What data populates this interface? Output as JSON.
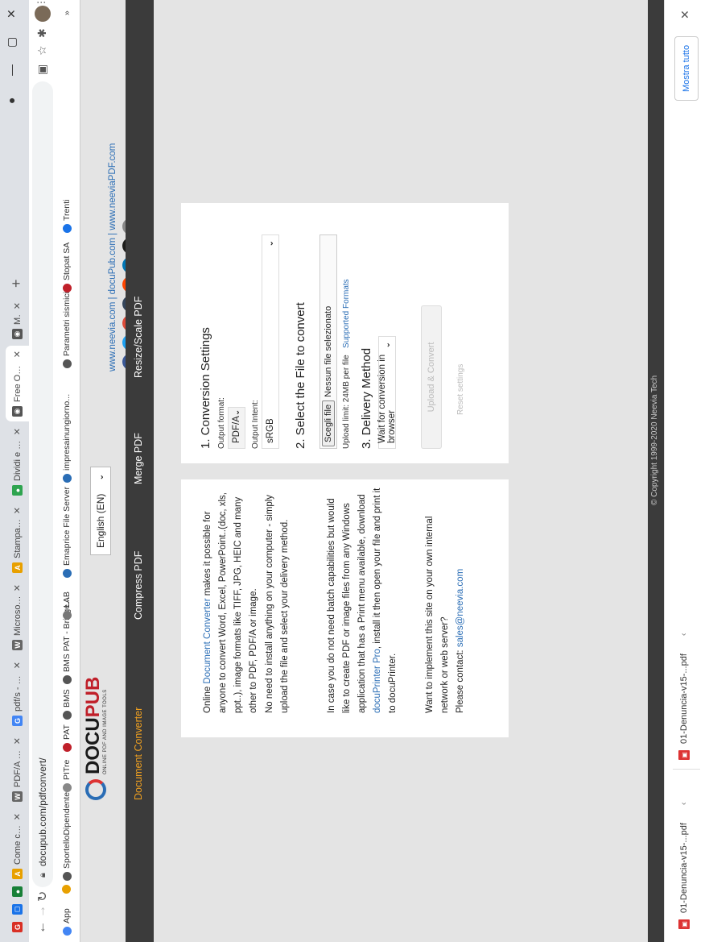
{
  "browser": {
    "tabs": [
      {
        "label": "",
        "icon_color": "#d93025",
        "icon_text": "G"
      },
      {
        "label": "",
        "icon_color": "#1a73e8",
        "icon_text": "◻"
      },
      {
        "label": "",
        "icon_color": "#188038",
        "icon_text": "●"
      },
      {
        "label": "Come conv",
        "icon_color": "#e8a000",
        "icon_text": "A"
      },
      {
        "label": "PDF/A - Wik",
        "icon_color": "#666666",
        "icon_text": "W"
      },
      {
        "label": "pdf/s - Rice",
        "icon_color": "#4285f4",
        "icon_text": "G"
      },
      {
        "label": "Microsoft W",
        "icon_color": "#666666",
        "icon_text": "W"
      },
      {
        "label": "Stampante",
        "icon_color": "#e8a000",
        "icon_text": "A"
      },
      {
        "label": "Dividi e unir",
        "icon_color": "#2ea44f",
        "icon_text": "●"
      },
      {
        "label": "Free Online",
        "icon_color": "#555555",
        "icon_text": "◉"
      },
      {
        "label": "Mod",
        "icon_color": "#555555",
        "icon_text": "◉"
      }
    ],
    "url": "docupub.com/pdfconvert/",
    "bookmarks": [
      {
        "label": "App",
        "color": "#4285f4"
      },
      {
        "label": "",
        "color": "#e8a000"
      },
      {
        "label": "SportelloDipendente",
        "color": "#555555"
      },
      {
        "label": "PITre",
        "color": "#888888"
      },
      {
        "label": "PAT",
        "color": "#c0202a"
      },
      {
        "label": "BMS",
        "color": "#555555"
      },
      {
        "label": "BMS PAT - Bridge...",
        "color": "#555555"
      },
      {
        "label": "LAB",
        "color": "#777777"
      },
      {
        "label": "Emaprice File Server",
        "color": "#2a6db5"
      },
      {
        "label": "impresainungiorno...",
        "color": "#2a6db5"
      },
      {
        "label": "Parametri sismici",
        "color": "#555555"
      },
      {
        "label": "Stopat SA",
        "color": "#c0202a"
      },
      {
        "label": "Trenti",
        "color": "#1a73e8"
      }
    ]
  },
  "site": {
    "logo_main_a": "DOCU",
    "logo_main_b": "PUB",
    "logo_sub": "ONLINE PDF AND IMAGE TOOLS",
    "language": "English (EN)",
    "sitelinks": "www.neevia.com  |  docuPub.com  |  www.neeviaPDF.com",
    "social": [
      {
        "icon": "facebook-icon",
        "glyph": "f",
        "color": "#3b5998"
      },
      {
        "icon": "twitter-icon",
        "glyph": "t",
        "color": "#1da1f2"
      },
      {
        "icon": "googleplus-icon",
        "glyph": "g",
        "color": "#dd4b39"
      },
      {
        "icon": "tumblr-icon",
        "glyph": "t",
        "color": "#35465c"
      },
      {
        "icon": "reddit-icon",
        "glyph": "r",
        "color": "#ff4500"
      },
      {
        "icon": "linkedin-icon",
        "glyph": "in",
        "color": "#0077b5"
      },
      {
        "icon": "digg-icon",
        "glyph": "d",
        "color": "#1d1d1b"
      },
      {
        "icon": "email-icon",
        "glyph": "✉",
        "color": "#888888"
      }
    ],
    "nav": [
      "Document Converter",
      "Compress PDF",
      "Merge PDF",
      "Resize/Scale PDF"
    ],
    "intro": {
      "p1_pre": "Online ",
      "p1_link": "Document Converter",
      "p1_post": " makes it possible for anyone to convert Word, Excel, PowerPoint..(doc, xls, ppt..), image formats like TIFF, JPG, HEIC and many other to PDF, PDF/A or image.",
      "p2": "No need to install anything on your computer - simply upload the file and select your delivery method.",
      "p3_pre": "In case you do not need batch capabilities but would like to create PDF or image files from any Windows application that has a Print menu available, download ",
      "p3_link": "docuPrinter Pro",
      "p3_post": ", install it then open your file and print it to docuPrinter.",
      "p4": "Want to implement this site on your own internal network or web server?",
      "p5_pre": "Please contact: ",
      "p5_link": "sales@neevia.com"
    },
    "settings": {
      "heading1": "1. Conversion Settings",
      "output_format_label": "Output format:",
      "output_format": "PDF/A",
      "output_intent_label": "Output Intent:",
      "output_intent": "sRGB",
      "heading2": "2. Select the File to convert",
      "choose_file": "Scegli file",
      "no_file": "Nessun file selezionato",
      "upload_limit": "Upload limit: 24MB per file",
      "supported_formats": "Supported Formats",
      "heading3": "3. Delivery Method",
      "delivery": "Wait for conversion in browser",
      "upload_button": "Upload & Convert",
      "reset": "Reset settings"
    },
    "copyright": "© Copyright 1999-2020 Neevia Tech"
  },
  "downloads": {
    "items": [
      "01-Denuncia-v15-...pdf",
      "01-Denuncia-v15-...pdf"
    ],
    "show_all": "Mostra tutto"
  }
}
